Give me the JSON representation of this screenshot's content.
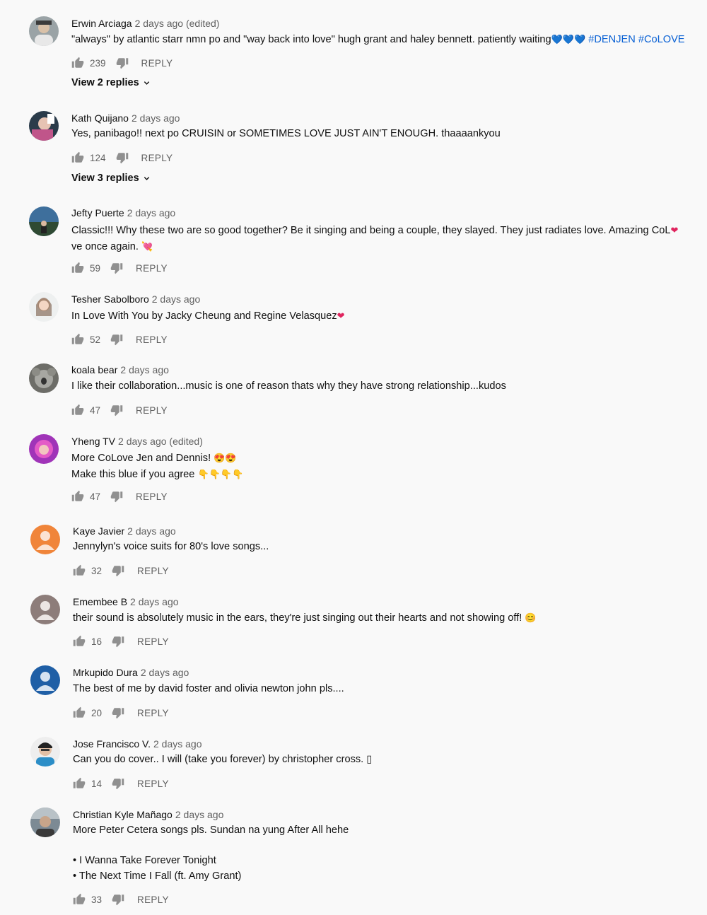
{
  "comments": [
    {
      "author": "Erwin Arciaga",
      "time": "2 days ago (edited)",
      "text": "\"always\" by atlantic starr nmn po and \"way back into love\" hugh grant and haley bennett. patiently waiting",
      "hearts": "💙💙💙",
      "tags": "#DENJEN #CoLOVE",
      "likes": "239",
      "reply": "REPLY",
      "view_replies": "View 2 replies"
    },
    {
      "author": "Kath Quijano",
      "time": "2 days ago",
      "text": "Yes, panibago!! next po CRUISIN or SOMETIMES LOVE JUST AIN'T ENOUGH. thaaaankyou",
      "likes": "124",
      "reply": "REPLY",
      "view_replies": "View 3 replies"
    },
    {
      "author": "Jefty Puerte",
      "time": "2 days ago",
      "text_line1": "Classic!!! Why these two are so good together? Be it singing and being a couple, they slayed. They just radiates love. Amazing CoL",
      "text_line2": "ve once again. ",
      "heart1": "❤",
      "heart2": "💘",
      "likes": "59",
      "reply": "REPLY"
    },
    {
      "author": "Tesher Sabolboro",
      "time": "2 days ago",
      "text": "In Love With You by Jacky Cheung and Regine Velasquez",
      "heart": "❤",
      "likes": "52",
      "reply": "REPLY"
    },
    {
      "author": "koala bear",
      "time": "2 days ago",
      "text": "I like their collaboration...music is one of reason thats why they have strong relationship...kudos",
      "likes": "47",
      "reply": "REPLY"
    },
    {
      "author": "Yheng TV",
      "time": "2 days ago (edited)",
      "text_line1": "More CoLove Jen and Dennis! ",
      "emoji1": "😍😍",
      "text_line2": "Make this blue if you agree ",
      "emoji2": "👇👇👇👇",
      "likes": "47",
      "reply": "REPLY"
    },
    {
      "author": "Kaye Javier",
      "time": "2 days ago",
      "text": "Jennylyn's voice suits for 80's love songs...",
      "likes": "32",
      "reply": "REPLY"
    },
    {
      "author": "Emembee B",
      "time": "2 days ago",
      "text": "their sound is absolutely music in the ears, they're just singing out their hearts and not showing off! ",
      "emoji": "😊",
      "likes": "16",
      "reply": "REPLY"
    },
    {
      "author": "Mrkupido Dura",
      "time": "2 days ago",
      "text": "The best of me by david foster and olivia newton john pls....",
      "likes": "20",
      "reply": "REPLY"
    },
    {
      "author": "Jose Francisco V.",
      "time": "2 days ago",
      "text": "Can you do cover.. I will (take you forever) by christopher cross. ",
      "glyph": "▯",
      "likes": "14",
      "reply": "REPLY"
    },
    {
      "author": "Christian Kyle Mañago",
      "time": "2 days ago",
      "text": "More Peter Cetera songs pls. Sundan na yung After All hehe",
      "bullet1": "• I Wanna Take Forever Tonight",
      "bullet2": "• The Next Time I Fall (ft. Amy Grant)",
      "likes": "33",
      "reply": "REPLY"
    }
  ],
  "colors": {
    "link": "#065fd4",
    "muted": "#606060",
    "avatar_orange": "#f0853a",
    "avatar_gray": "#8d7d7a",
    "avatar_blue": "#1f5fa6"
  },
  "icons": [
    "thumb-up-icon",
    "thumb-down-icon",
    "chevron-down-icon",
    "avatar-icon"
  ]
}
